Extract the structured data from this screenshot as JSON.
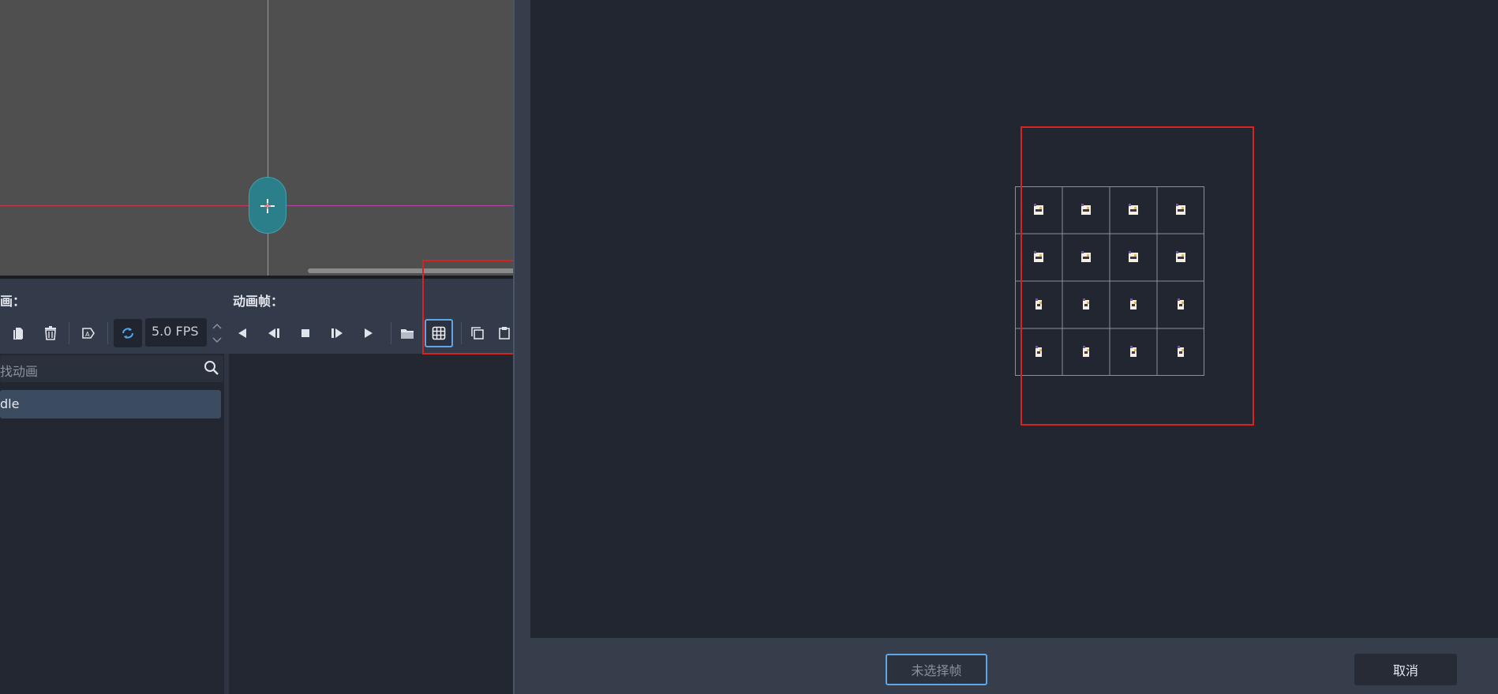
{
  "panel": {
    "animations_header": "画：",
    "frames_header": "动画帧：",
    "fps_value": "5.0 FPS",
    "search_placeholder": "找动画",
    "animations": [
      "dle"
    ]
  },
  "dialog": {
    "no_selection_button": "未选择帧",
    "cancel_button": "取消",
    "sheet": {
      "columns": 4,
      "rows": 4
    }
  },
  "colors": {
    "accent": "#5fa6e6",
    "highlight_box": "#d92222",
    "loop_icon": "#4fa9f2"
  },
  "icons": {
    "toolbar": [
      "paste-icon",
      "delete-icon",
      "autoplay-icon",
      "loop-icon",
      "play-backwards-from-end-icon",
      "play-backwards-icon",
      "stop-icon",
      "play-icon",
      "play-from-start-icon",
      "open-folder-icon",
      "sprite-sheet-grid-icon",
      "copy-icon",
      "paste-frame-icon"
    ]
  }
}
